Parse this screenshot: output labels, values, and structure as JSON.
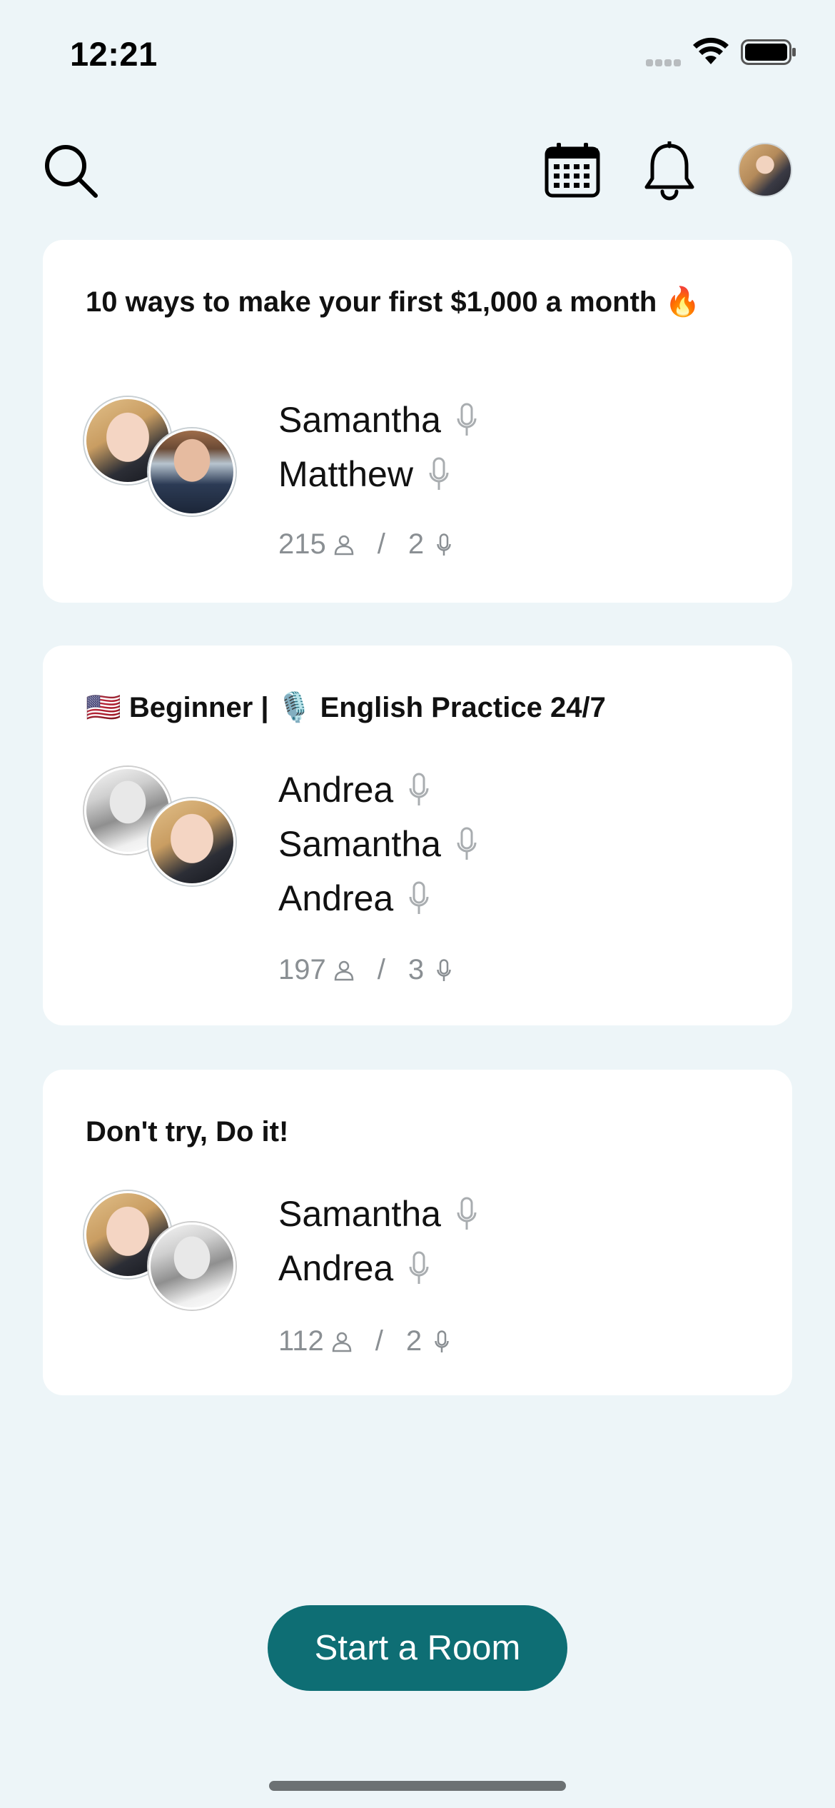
{
  "status_bar": {
    "time": "12:21"
  },
  "nav": {
    "search_icon": "search-icon",
    "calendar_icon": "calendar-icon",
    "bell_icon": "bell-icon",
    "avatar": "profile-avatar"
  },
  "rooms": [
    {
      "title": "10 ways to make your first $1,000 a month 🔥",
      "speakers": [
        "Samantha",
        "Matthew"
      ],
      "listeners": "215",
      "speaker_count": "2"
    },
    {
      "title": "🇺🇸 Beginner | 🎙️ English Practice 24/7",
      "speakers": [
        "Andrea",
        "Samantha",
        "Andrea"
      ],
      "listeners": "197",
      "speaker_count": "3"
    },
    {
      "title": "Don't try, Do it!",
      "speakers": [
        "Samantha",
        "Andrea"
      ],
      "listeners": "112",
      "speaker_count": "2"
    }
  ],
  "stats_separator": "/",
  "start_room_label": "Start a Room",
  "colors": {
    "background": "#EDF5F8",
    "card": "#FFFFFF",
    "accent": "#0E6E74",
    "muted_text": "#8A8F93"
  }
}
